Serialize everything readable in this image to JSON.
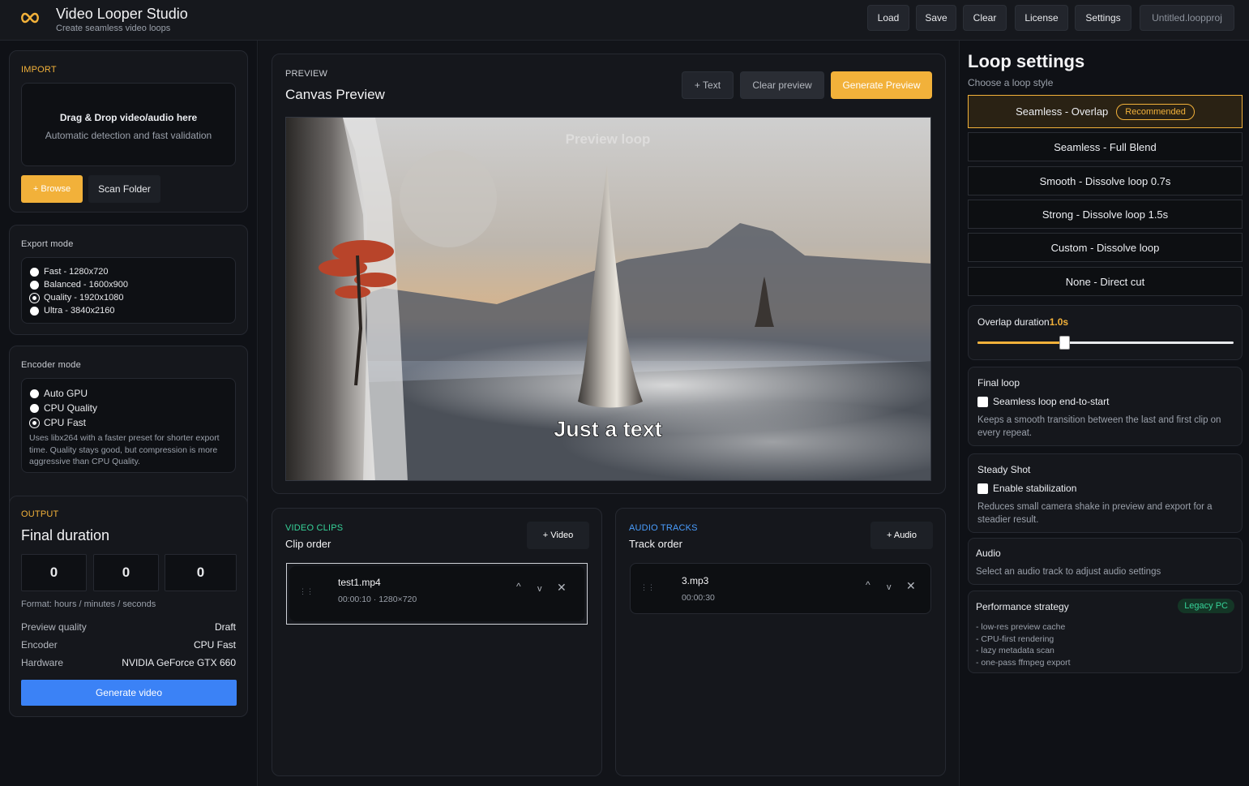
{
  "header": {
    "title": "Video Looper Studio",
    "subtitle": "Create seamless video loops",
    "buttons": [
      "Load",
      "Save",
      "Clear",
      "License",
      "Settings"
    ],
    "project_name": "Untitled.loopproj"
  },
  "import": {
    "label": "IMPORT",
    "drop_title": "Drag & Drop video/audio here",
    "drop_sub": "Automatic detection and fast validation",
    "browse": "+ Browse",
    "scan": "Scan Folder"
  },
  "export_mode": {
    "label": "Export mode",
    "options": [
      "Fast - 1280x720",
      "Balanced - 1600x900",
      "Quality - 1920x1080",
      "Ultra - 3840x2160"
    ],
    "selected": "Quality - 1920x1080"
  },
  "encoder_mode": {
    "label": "Encoder mode",
    "options": [
      "Auto GPU",
      "CPU Quality",
      "CPU Fast"
    ],
    "selected": "CPU Fast",
    "note": "Uses libx264 with a faster preset for shorter export time. Quality stays good, but compression is more aggressive than CPU Quality."
  },
  "output": {
    "label": "OUTPUT",
    "title": "Final duration",
    "hours": "0",
    "minutes": "0",
    "seconds": "0",
    "format_note": "Format: hours / minutes / seconds",
    "rows": [
      {
        "k": "Preview quality",
        "v": "Draft"
      },
      {
        "k": "Encoder",
        "v": "CPU Fast"
      },
      {
        "k": "Hardware",
        "v": "NVIDIA GeForce GTX 660"
      }
    ],
    "generate": "Generate video"
  },
  "preview": {
    "label": "PREVIEW",
    "title": "Canvas Preview",
    "text_btn": "+ Text",
    "clear_btn": "Clear preview",
    "generate_btn": "Generate Preview",
    "watermark": "Preview loop",
    "overlay_text": "Just a text"
  },
  "clips": {
    "label": "VIDEO CLIPS",
    "title": "Clip order",
    "add": "+ Video",
    "items": [
      {
        "name": "test1.mp4",
        "meta": "00:00:10 · 1280×720"
      }
    ]
  },
  "audio": {
    "label": "AUDIO TRACKS",
    "title": "Track order",
    "add": "+ Audio",
    "items": [
      {
        "name": "3.mp3",
        "meta": "00:00:30"
      }
    ]
  },
  "loop": {
    "title": "Loop settings",
    "subtitle": "Choose a loop style",
    "options": [
      "Seamless - Overlap",
      "Seamless - Full Blend",
      "Smooth - Dissolve loop 0.7s",
      "Strong - Dissolve loop 1.5s",
      "Custom - Dissolve loop",
      "None - Direct cut"
    ],
    "recommended": "Recommended",
    "overlap_label": "Overlap duration",
    "overlap_value": "1.0s",
    "overlap_fraction": 0.34,
    "final_loop": {
      "title": "Final loop",
      "check": "Seamless loop end-to-start",
      "desc": "Keeps a smooth transition between the last and first clip on every repeat."
    },
    "steady": {
      "title": "Steady Shot",
      "check": "Enable stabilization",
      "desc": "Reduces small camera shake in preview and export for a steadier result."
    },
    "audio": {
      "title": "Audio",
      "desc": "Select an audio track to adjust audio settings"
    },
    "perf": {
      "title": "Performance strategy",
      "badge": "Legacy PC",
      "items": [
        "- low-res preview cache",
        "- CPU-first rendering",
        "- lazy metadata scan",
        "- one-pass ffmpeg export"
      ]
    }
  },
  "colors": {
    "accent": "#f2b13a",
    "blue": "#3b82f6",
    "green": "#36d399"
  }
}
